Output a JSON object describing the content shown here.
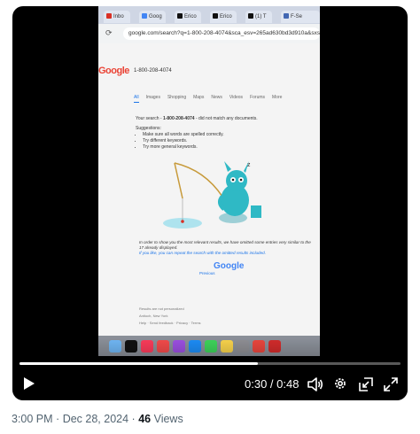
{
  "browser": {
    "tabs": [
      "Inbo",
      "Goog",
      "Erico",
      "Erico",
      "(1) T",
      "F-Se"
    ],
    "tab_colors": [
      "#d93025",
      "#4285f4",
      "#111111",
      "#111111",
      "#111111",
      "#4267b2"
    ],
    "reload_icon": "reload-icon",
    "url": "google.com/search?q=1-800-208-4074&sca_esv=265ad630bd3d910a&sxsrf=A"
  },
  "search_page": {
    "logo": "Google",
    "query": "1-800-208-4074",
    "nav_tabs": [
      "All",
      "Images",
      "Shopping",
      "Maps",
      "News",
      "Videos",
      "Forums",
      "More"
    ],
    "no_match_prefix": "Your search -",
    "no_match_query": "1-800-208-4074",
    "no_match_suffix": "- did not match any documents.",
    "suggestions_heading": "Suggestions:",
    "suggestions": [
      "Make sure all words are spelled correctly.",
      "Try different keywords.",
      "Try more general keywords."
    ],
    "omitted_text": "In order to show you the most relevant results, we have omitted some entries very similar to the 17 already displayed.",
    "omitted_link_text": "If you like, you can repeat the search with the omitted results included.",
    "pagination_logo": "Google",
    "previous_label": "Previous",
    "footer_note": "Results are not personalized",
    "footer_location": "Antioch, New York",
    "footer_links": [
      "Help",
      "Send feedback",
      "Privacy",
      "Terms"
    ]
  },
  "dock": {
    "icons": [
      "finder",
      "apple-tv",
      "music",
      "news",
      "podcasts",
      "app-store",
      "messages",
      "notes",
      "system-settings",
      "chrome",
      "photo-booth"
    ]
  },
  "player": {
    "time": "0:30 / 0:48",
    "progress": 0.625
  },
  "post_meta": {
    "time": "3:00 PM",
    "date": "Dec 28, 2024",
    "views_count": "46",
    "views_label": "Views",
    "separator": "·"
  }
}
